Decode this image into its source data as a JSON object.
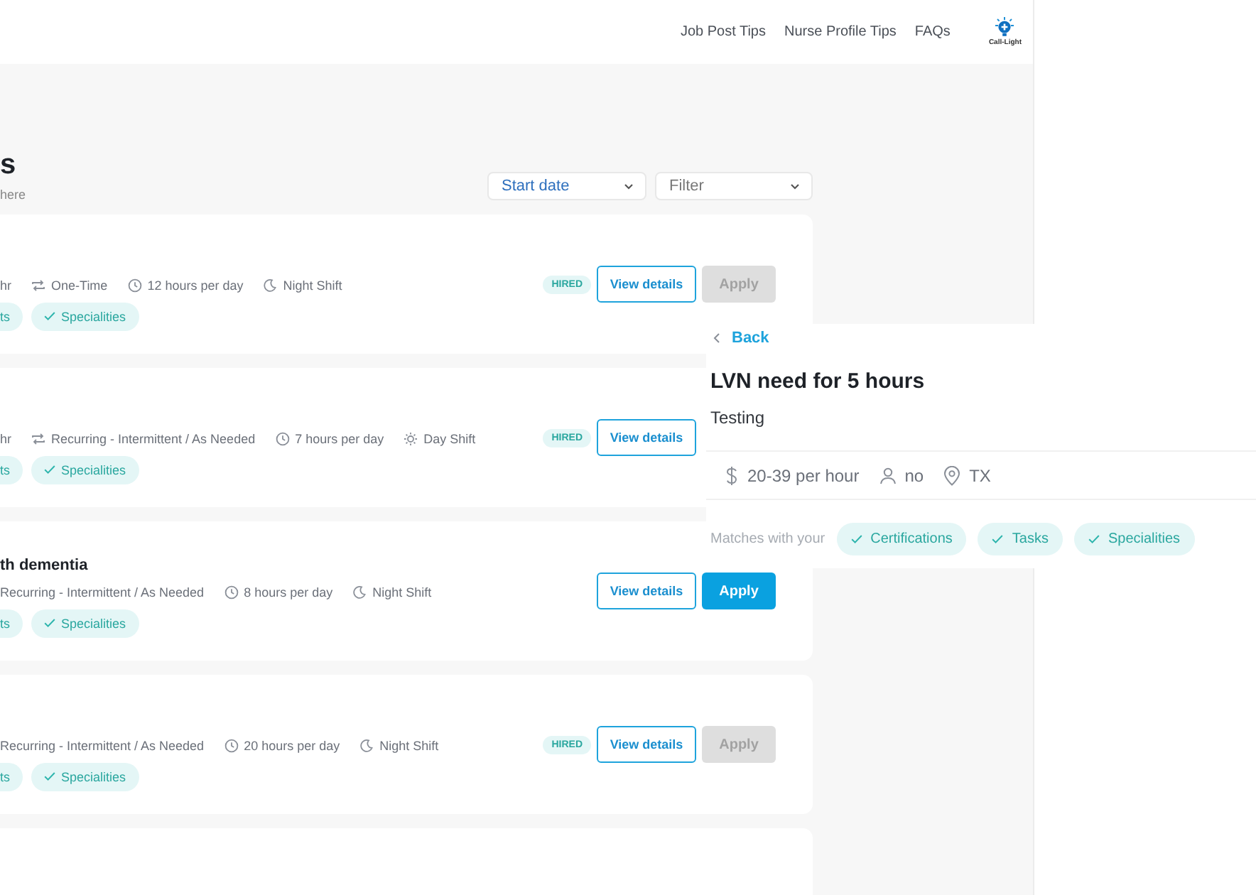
{
  "nav": {
    "links": [
      "Job Post Tips",
      "Nurse Profile Tips",
      "FAQs"
    ],
    "logo_text": "Call-Light"
  },
  "page": {
    "title": "s",
    "subtitle": "here"
  },
  "sort": {
    "label": "Start date"
  },
  "filter": {
    "label": "Filter"
  },
  "cards": [
    {
      "kind": "job",
      "meta": [
        {
          "kind": "pay",
          "text": "hr"
        },
        {
          "kind": "repeat",
          "text": "One-Time"
        },
        {
          "kind": "clock",
          "text": "12 hours per day"
        },
        {
          "kind": "moon",
          "text": "Night Shift"
        }
      ],
      "chips": [
        {
          "label": "ts",
          "cut": true
        },
        {
          "label": "Specialities",
          "cut": false
        }
      ],
      "status": "HIRED",
      "view_label": "View details",
      "apply": {
        "label": "Apply",
        "disabled": true
      }
    },
    {
      "kind": "job",
      "meta": [
        {
          "kind": "pay",
          "text": "hr"
        },
        {
          "kind": "repeat",
          "text": "Recurring - Intermittent / As Needed"
        },
        {
          "kind": "clock",
          "text": "7 hours per day"
        },
        {
          "kind": "sun",
          "text": "Day Shift"
        }
      ],
      "chips": [
        {
          "label": "ts",
          "cut": true
        },
        {
          "label": "Specialities",
          "cut": false
        }
      ],
      "status": "HIRED",
      "view_label": "View details"
    },
    {
      "kind": "job",
      "title": "th dementia",
      "meta": [
        {
          "kind": "pay",
          "text": "Recurring - Intermittent / As Needed"
        },
        {
          "kind": "clock",
          "text": "8 hours per day"
        },
        {
          "kind": "moon",
          "text": "Night Shift"
        }
      ],
      "chips": [
        {
          "label": "ts",
          "cut": true
        },
        {
          "label": "Specialities",
          "cut": false
        }
      ],
      "view_label": "View details",
      "apply": {
        "label": "Apply",
        "disabled": false
      }
    },
    {
      "kind": "job",
      "meta": [
        {
          "kind": "pay",
          "text": "Recurring - Intermittent / As Needed"
        },
        {
          "kind": "clock",
          "text": "20 hours per day"
        },
        {
          "kind": "moon",
          "text": "Night Shift"
        }
      ],
      "chips": [
        {
          "label": "ts",
          "cut": true
        },
        {
          "label": "Specialities",
          "cut": false
        }
      ],
      "status": "HIRED",
      "view_label": "View details",
      "apply": {
        "label": "Apply",
        "disabled": true
      }
    },
    {
      "kind": "stub"
    }
  ],
  "detail": {
    "back": "Back",
    "title": "LVN need for 5 hours",
    "description": "Testing",
    "facts": [
      {
        "kind": "dollar",
        "text": "20-39 per hour"
      },
      {
        "kind": "person",
        "text": "no"
      },
      {
        "kind": "pin",
        "text": "TX"
      }
    ],
    "matches_label": "Matches with your",
    "matches": [
      "Certifications",
      "Tasks",
      "Specialities"
    ]
  }
}
